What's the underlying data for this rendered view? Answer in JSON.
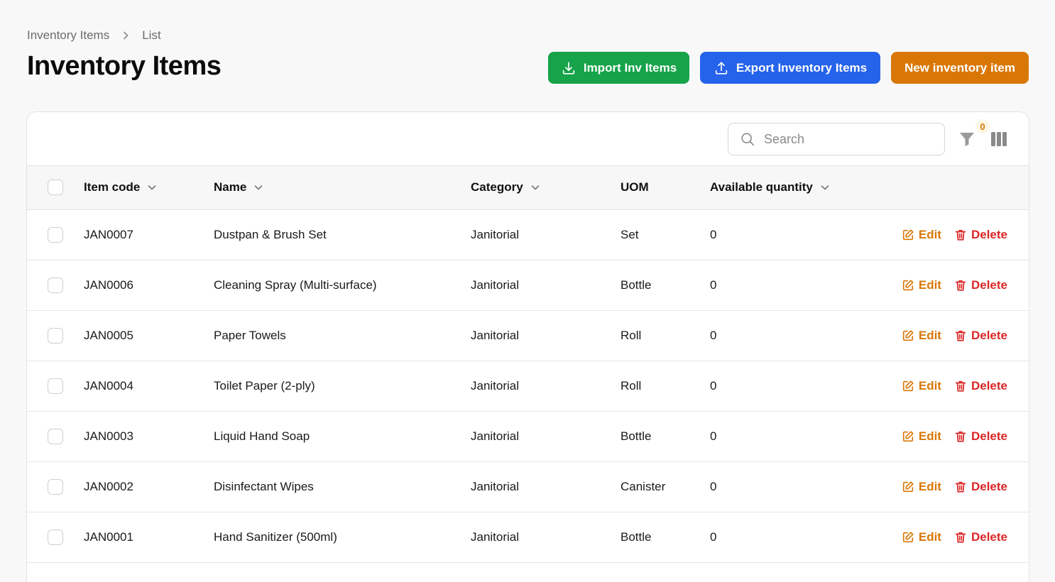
{
  "breadcrumb": {
    "root": "Inventory Items",
    "current": "List"
  },
  "page": {
    "title": "Inventory Items"
  },
  "actions": {
    "import_label": "Import Inv Items",
    "export_label": "Export Inventory Items",
    "new_label": "New inventory item"
  },
  "toolbar": {
    "search_placeholder": "Search",
    "filter_count": "0"
  },
  "table": {
    "headers": {
      "item_code": "Item code",
      "name": "Name",
      "category": "Category",
      "uom": "UOM",
      "available_quantity": "Available quantity"
    },
    "rows": [
      {
        "code": "JAN0007",
        "name": "Dustpan & Brush Set",
        "category": "Janitorial",
        "uom": "Set",
        "qty": "0",
        "edit": "Edit",
        "delete": "Delete"
      },
      {
        "code": "JAN0006",
        "name": "Cleaning Spray (Multi-surface)",
        "category": "Janitorial",
        "uom": "Bottle",
        "qty": "0",
        "edit": "Edit",
        "delete": "Delete"
      },
      {
        "code": "JAN0005",
        "name": "Paper Towels",
        "category": "Janitorial",
        "uom": "Roll",
        "qty": "0",
        "edit": "Edit",
        "delete": "Delete"
      },
      {
        "code": "JAN0004",
        "name": "Toilet Paper (2-ply)",
        "category": "Janitorial",
        "uom": "Roll",
        "qty": "0",
        "edit": "Edit",
        "delete": "Delete"
      },
      {
        "code": "JAN0003",
        "name": "Liquid Hand Soap",
        "category": "Janitorial",
        "uom": "Bottle",
        "qty": "0",
        "edit": "Edit",
        "delete": "Delete"
      },
      {
        "code": "JAN0002",
        "name": "Disinfectant Wipes",
        "category": "Janitorial",
        "uom": "Canister",
        "qty": "0",
        "edit": "Edit",
        "delete": "Delete"
      },
      {
        "code": "JAN0001",
        "name": "Hand Sanitizer (500ml)",
        "category": "Janitorial",
        "uom": "Bottle",
        "qty": "0",
        "edit": "Edit",
        "delete": "Delete"
      }
    ]
  },
  "colors": {
    "import": "#16a34a",
    "export": "#2563eb",
    "new": "#d97706",
    "edit": "#d97706",
    "delete": "#dc2626"
  },
  "icons": [
    "download-icon",
    "upload-icon",
    "search-icon",
    "filter-icon",
    "columns-icon",
    "chevron-down-icon",
    "chevron-right-icon",
    "edit-icon",
    "trash-icon"
  ]
}
